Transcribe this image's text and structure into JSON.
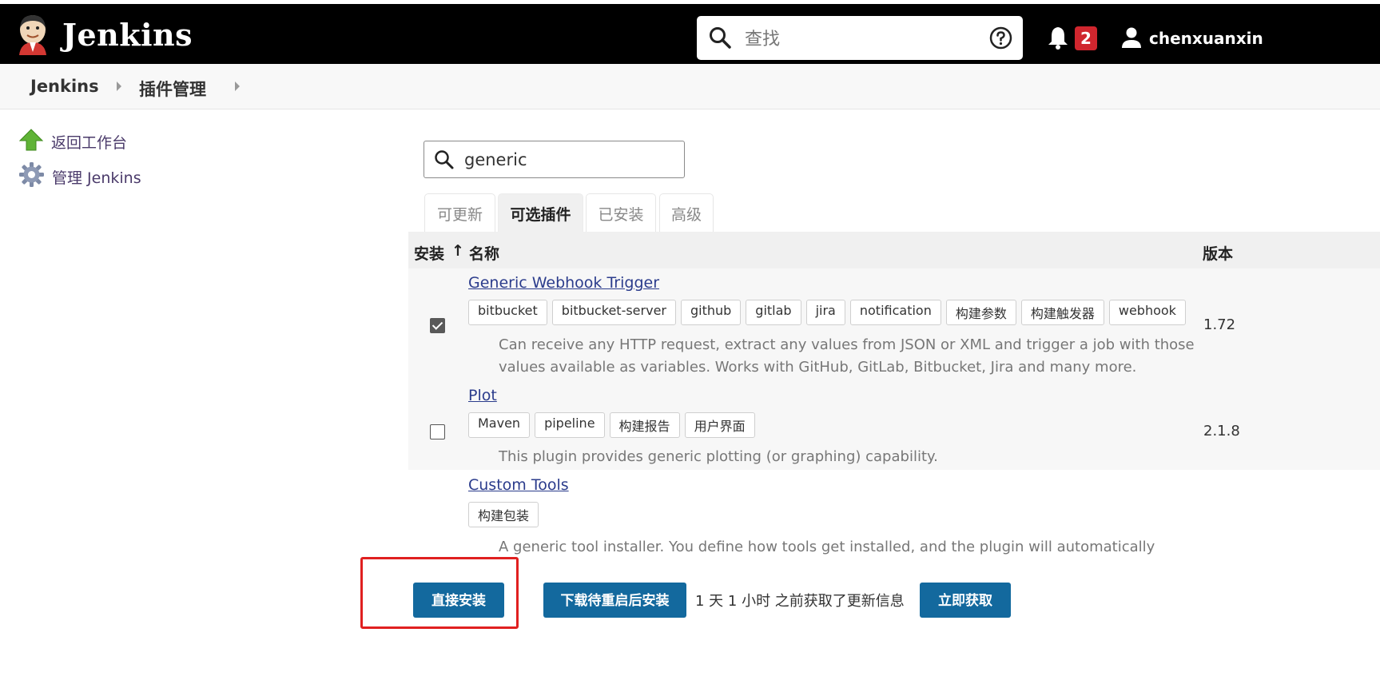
{
  "header": {
    "title": "Jenkins",
    "search_placeholder": "查找",
    "notification_count": "2",
    "user_name": "chenxuanxin",
    "colors": {
      "bar": "#000000",
      "badge": "#d0262e"
    }
  },
  "breadcrumb": {
    "items": [
      "Jenkins",
      "插件管理"
    ]
  },
  "sidebar": {
    "items": [
      {
        "label": "返回工作台",
        "icon": "up-arrow-icon"
      },
      {
        "label": "管理 Jenkins",
        "icon": "gear-icon"
      }
    ]
  },
  "filter": {
    "value": "generic"
  },
  "tabs": [
    {
      "label": "可更新",
      "active": false
    },
    {
      "label": "可选插件",
      "active": true
    },
    {
      "label": "已安装",
      "active": false
    },
    {
      "label": "高级",
      "active": false
    }
  ],
  "table": {
    "headers": {
      "install": "安装",
      "sort": "↑",
      "name": "名称",
      "version": "版本"
    },
    "rows": [
      {
        "name": "Generic Webhook Trigger",
        "checked": true,
        "tags": [
          "bitbucket",
          "bitbucket-server",
          "github",
          "gitlab",
          "jira",
          "notification",
          "构建参数",
          "构建触发器",
          "webhook"
        ],
        "description": "Can receive any HTTP request, extract any values from JSON or XML and trigger a job with those values available as variables. Works with GitHub, GitLab, Bitbucket, Jira and many more.",
        "version": "1.72"
      },
      {
        "name": "Plot",
        "checked": false,
        "tags": [
          "Maven",
          "pipeline",
          "构建报告",
          "用户界面"
        ],
        "description": "This plugin provides generic plotting (or graphing) capability.",
        "version": "2.1.8"
      },
      {
        "name": "Custom Tools",
        "checked": false,
        "tags": [
          "构建包装"
        ],
        "description": "A generic tool installer. You define how tools get installed, and the plugin will automatically install them",
        "version": ""
      }
    ]
  },
  "footer": {
    "install_now": "直接安装",
    "install_after_restart": "下载待重启后安装",
    "update_info": "1 天 1 小时 之前获取了更新信息",
    "check_now": "立即获取",
    "button_color": "#13699e",
    "highlight_color": "#e02020"
  }
}
